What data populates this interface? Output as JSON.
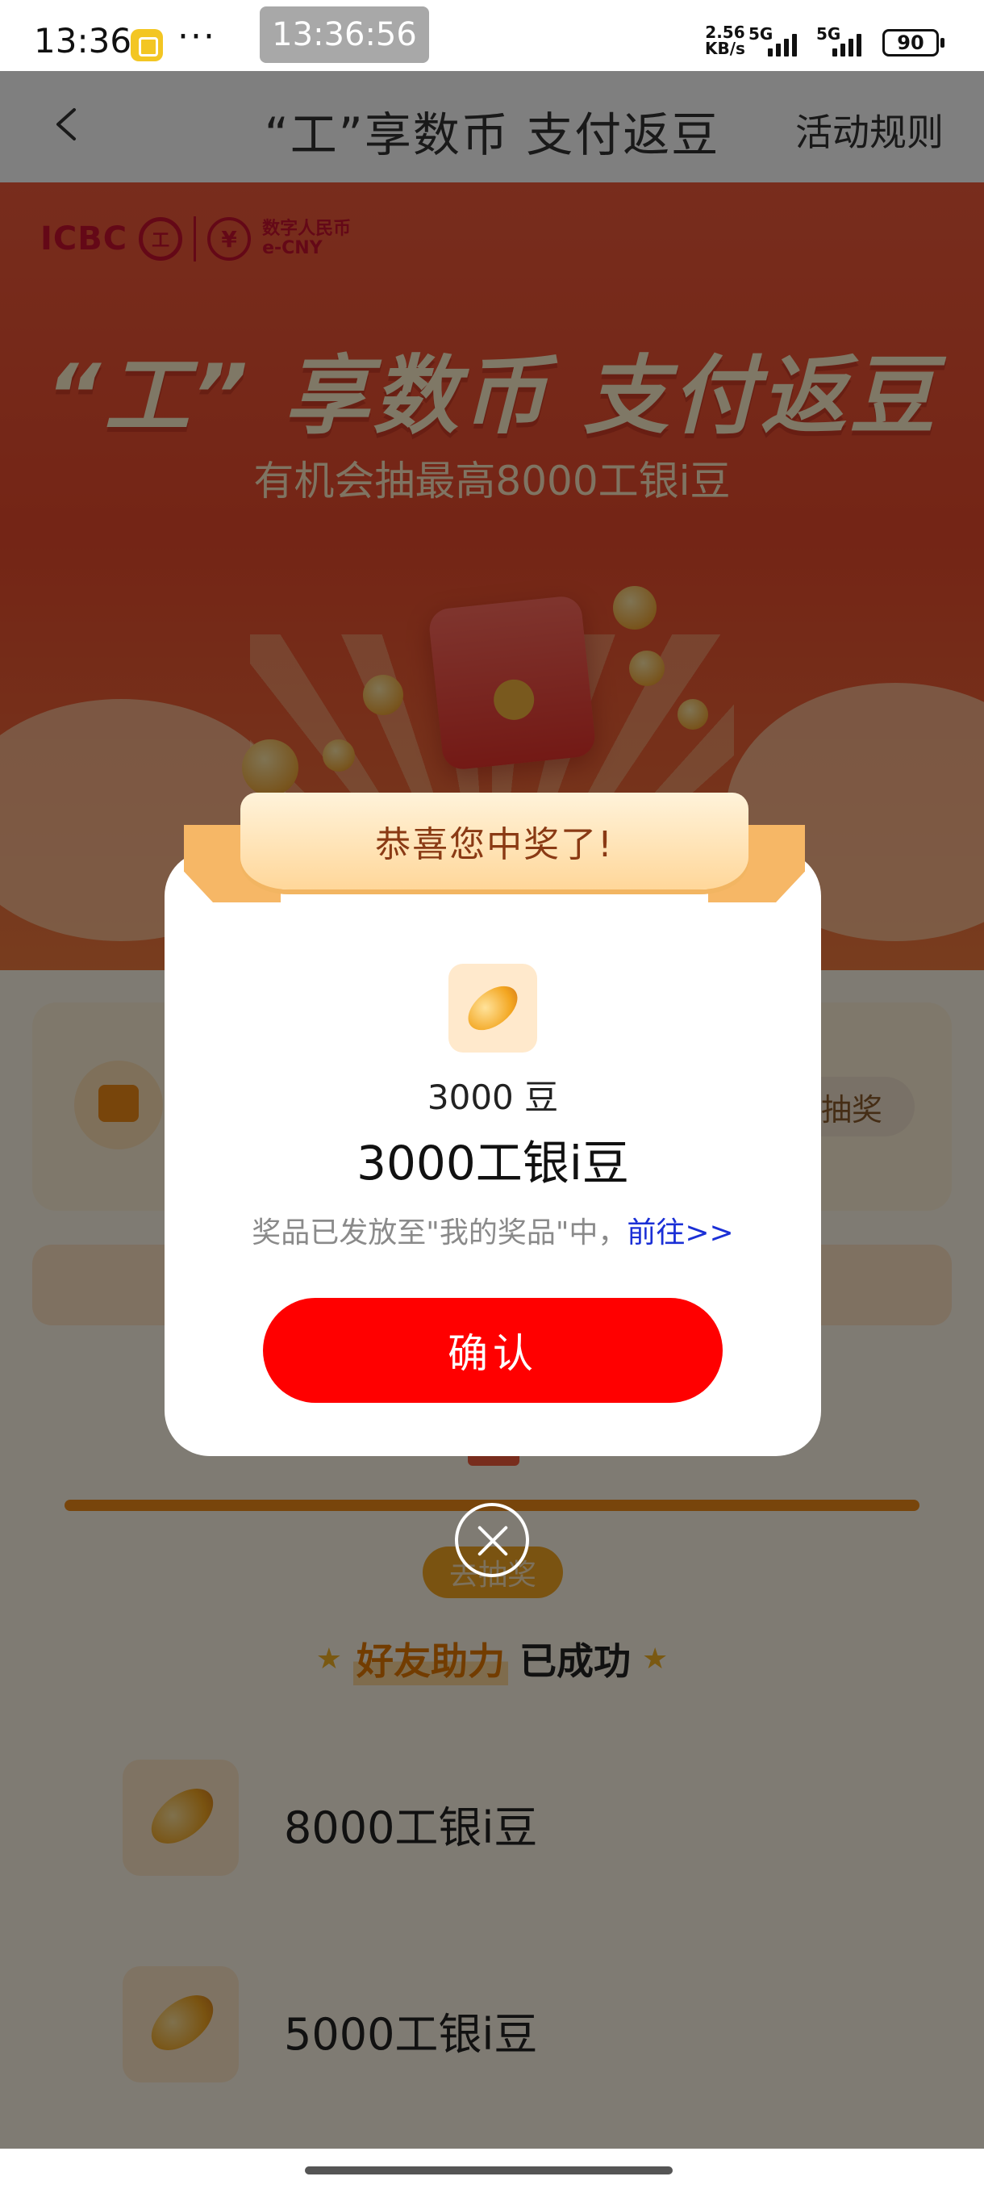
{
  "status_bar": {
    "time": "13:36",
    "dots": "···",
    "screen_clock": "13:36:56",
    "net_speed_value": "2.56",
    "net_speed_unit": "KB/s",
    "network_1": "5G",
    "network_2": "5G",
    "battery": "90"
  },
  "nav": {
    "title": "“工”享数币 支付返豆",
    "rules": "活动规则"
  },
  "hero": {
    "logo_icbc": "ICBC",
    "logo_seal": "工",
    "logo_ecny_icon": "¥",
    "logo_ecny_cn": "数字人民币",
    "logo_ecny_en": "e-CNY",
    "headline": "“工” 享数币 支付返豆",
    "subtitle": "有机会抽最高8000工银i豆"
  },
  "content": {
    "draw_pill": "抽奖",
    "track_button": "去抽奖",
    "helper_highlight": "好友助力",
    "helper_done": "已成功",
    "prizes": [
      {
        "name": "8000工银i豆"
      },
      {
        "name": "5000工银i豆"
      }
    ]
  },
  "modal": {
    "ribbon": "恭喜您中奖了!",
    "amount": "3000 豆",
    "prize": "3000工银i豆",
    "note": "奖品已发放至\"我的奖品\"中，",
    "link": "前往>>",
    "confirm": "确认"
  },
  "icons": [
    "back-icon",
    "calendar-icon",
    "bean-icon",
    "close-icon",
    "signal-icon",
    "battery-icon"
  ],
  "colors": {
    "accent_red": "#ff0000",
    "link_blue": "#1a2fd6",
    "hero_red": "#e94a2c",
    "gold": "#f08a17"
  }
}
